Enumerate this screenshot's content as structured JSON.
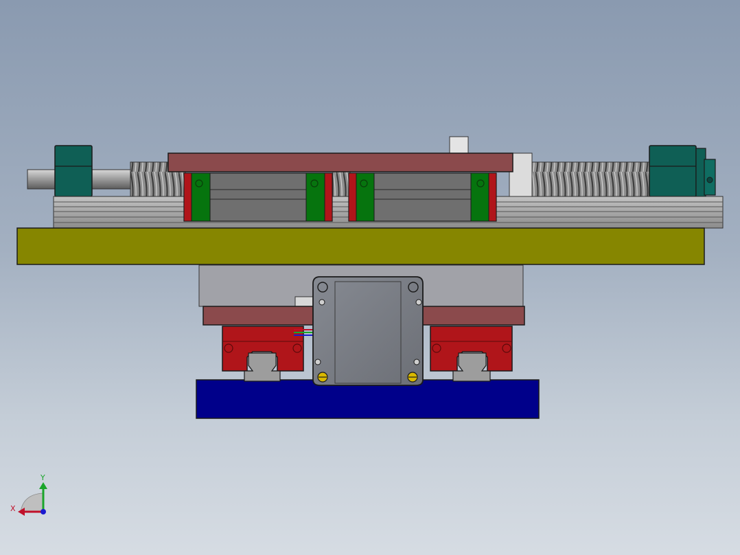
{
  "triad": {
    "x_label": "X",
    "y_label": "Y",
    "x_color": "#c0102a",
    "y_color": "#1aa52a",
    "z_color": "#1a1ad0"
  },
  "colors": {
    "background_top": "#8a9ab0",
    "background_bottom": "#d6dce3",
    "base_plate": "#868600",
    "bottom_block": "#00008a",
    "carriage_plate": "#8b4a4c",
    "guide_block": "#b0151a",
    "bearing_end": "#0f5f55",
    "end_seal": "#06740e",
    "rail": "#a3a3a3",
    "motor_face": "#7b7e86"
  }
}
